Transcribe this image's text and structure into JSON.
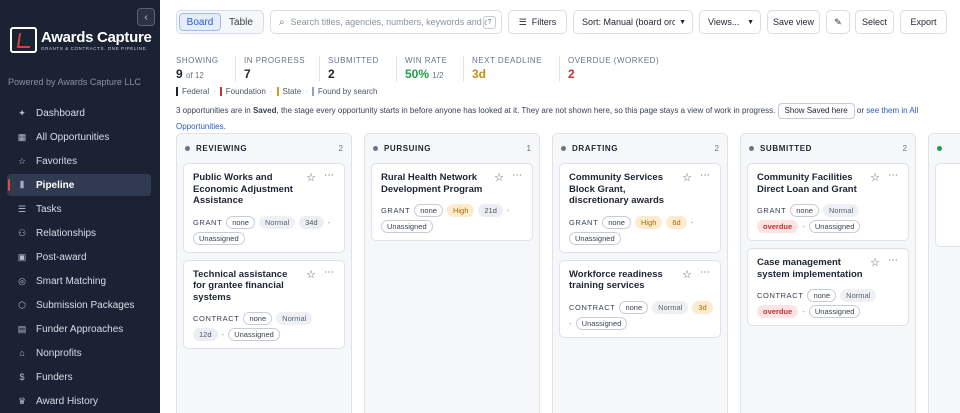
{
  "sidebar": {
    "collapse_icon": "chevron-left-icon",
    "logo_text": "Awards Capture",
    "logo_tagline": "GRANTS & CONTRACTS. ONE PIPELINE.",
    "powered_by": "Powered by Awards Capture LLC",
    "items": [
      {
        "label": "Dashboard",
        "icon": "sparkle-icon",
        "glyph": "✦"
      },
      {
        "label": "All Opportunities",
        "icon": "grid-icon",
        "glyph": "▦"
      },
      {
        "label": "Favorites",
        "icon": "star-icon",
        "glyph": "☆"
      },
      {
        "label": "Pipeline",
        "icon": "kanban-icon",
        "glyph": "⫴"
      },
      {
        "label": "Tasks",
        "icon": "list-icon",
        "glyph": "☰"
      },
      {
        "label": "Relationships",
        "icon": "people-icon",
        "glyph": "⚇"
      },
      {
        "label": "Post-award",
        "icon": "clipboard-icon",
        "glyph": "▣"
      },
      {
        "label": "Smart Matching",
        "icon": "target-icon",
        "glyph": "◎"
      },
      {
        "label": "Submission Packages",
        "icon": "package-icon",
        "glyph": "⬡"
      },
      {
        "label": "Funder Approaches",
        "icon": "book-icon",
        "glyph": "▤"
      },
      {
        "label": "Nonprofits",
        "icon": "building-icon",
        "glyph": "⌂"
      },
      {
        "label": "Funders",
        "icon": "dollar-icon",
        "glyph": "$"
      },
      {
        "label": "Award History",
        "icon": "trophy-icon",
        "glyph": "♛"
      }
    ],
    "active_index": 3
  },
  "toolbar": {
    "view_board": "Board",
    "view_table": "Table",
    "search_placeholder": "Search titles, agencies, numbers, keywords and descriptions",
    "search_help": "?",
    "filters": "Filters",
    "sort": "Sort: Manual (board order)",
    "views": "Views...",
    "save_view": "Save view",
    "edit_glyph": "✎",
    "select": "Select",
    "export": "Export"
  },
  "stats": {
    "showing_label": "SHOWING",
    "showing_value": "9",
    "showing_of": "of 12",
    "in_progress_label": "IN PROGRESS",
    "in_progress_value": "7",
    "submitted_label": "SUBMITTED",
    "submitted_value": "2",
    "win_rate_label": "WIN RATE",
    "win_rate_value": "50%",
    "win_rate_sub": "1/2",
    "next_deadline_label": "NEXT DEADLINE",
    "next_deadline_value": "3d",
    "overdue_label": "OVERDUE (WORKED)",
    "overdue_value": "2"
  },
  "legend": [
    {
      "label": "Federal",
      "color": "#1b2233"
    },
    {
      "label": "Foundation",
      "color": "#c3322f"
    },
    {
      "label": "State",
      "color": "#d79a2b"
    },
    {
      "label": "Found by search",
      "color": "#9aa1ae"
    }
  ],
  "notice": {
    "part1": "3 opportunities are in ",
    "saved": "Saved",
    "part2": ", the stage every opportunity starts in before anyone has looked at it. They are not shown here, so this page stays a view of work in progress.",
    "button": "Show Saved here",
    "or": " or ",
    "link": "see them in All Opportunities",
    "end": "."
  },
  "columns": [
    {
      "name": "REVIEWING",
      "count": "2",
      "cards": [
        {
          "title": "Public Works and Economic Adjustment Assistance",
          "type": "GRANT",
          "chips": [
            {
              "t": "none",
              "k": "out"
            },
            {
              "t": "Normal",
              "k": "normal"
            },
            {
              "t": "34d",
              "k": "days"
            },
            {
              "t": "-",
              "k": "dash"
            },
            {
              "t": "Unassigned",
              "k": "out"
            }
          ]
        },
        {
          "title": "Technical assistance for grantee financial systems",
          "type": "CONTRACT",
          "chips": [
            {
              "t": "none",
              "k": "out"
            },
            {
              "t": "Normal",
              "k": "normal"
            },
            {
              "t": "12d",
              "k": "days"
            },
            {
              "t": "-",
              "k": "dash"
            },
            {
              "t": "Unassigned",
              "k": "out"
            }
          ]
        }
      ]
    },
    {
      "name": "PURSUING",
      "count": "1",
      "cards": [
        {
          "title": "Rural Health Network Development Program",
          "type": "GRANT",
          "chips": [
            {
              "t": "none",
              "k": "out"
            },
            {
              "t": "High",
              "k": "high"
            },
            {
              "t": "21d",
              "k": "days"
            },
            {
              "t": "-",
              "k": "dash"
            },
            {
              "t": "Unassigned",
              "k": "out"
            }
          ]
        }
      ]
    },
    {
      "name": "DRAFTING",
      "count": "2",
      "cards": [
        {
          "title": "Community Services Block Grant, discretionary awards",
          "type": "GRANT",
          "chips": [
            {
              "t": "none",
              "k": "out"
            },
            {
              "t": "High",
              "k": "high"
            },
            {
              "t": "6d",
              "k": "days-warn"
            },
            {
              "t": "-",
              "k": "dash"
            },
            {
              "t": "Unassigned",
              "k": "out"
            }
          ]
        },
        {
          "title": "Workforce readiness training services",
          "type": "CONTRACT",
          "chips": [
            {
              "t": "none",
              "k": "out"
            },
            {
              "t": "Normal",
              "k": "normal"
            },
            {
              "t": "3d",
              "k": "days-warn"
            },
            {
              "t": "-",
              "k": "dash"
            },
            {
              "t": "Unassigned",
              "k": "out"
            }
          ]
        }
      ]
    },
    {
      "name": "SUBMITTED",
      "count": "2",
      "cards": [
        {
          "title": "Community Facilities Direct Loan and Grant",
          "type": "GRANT",
          "chips": [
            {
              "t": "none",
              "k": "out"
            },
            {
              "t": "Normal",
              "k": "normal"
            },
            {
              "t": "overdue",
              "k": "over"
            },
            {
              "t": "-",
              "k": "dash"
            },
            {
              "t": "Unassigned",
              "k": "out"
            }
          ]
        },
        {
          "title": "Case management system implementation",
          "type": "CONTRACT",
          "chips": [
            {
              "t": "none",
              "k": "out"
            },
            {
              "t": "Normal",
              "k": "normal"
            },
            {
              "t": "overdue",
              "k": "over"
            },
            {
              "t": "-",
              "k": "dash"
            },
            {
              "t": "Unassigned",
              "k": "out"
            }
          ]
        }
      ]
    }
  ],
  "colors": {
    "accent": "#2a5cc4",
    "win_rate": "#1f9d4a",
    "deadline": "#c98a12",
    "overdue": "#c3322f",
    "next_column_dot": "#1f9d4a"
  }
}
